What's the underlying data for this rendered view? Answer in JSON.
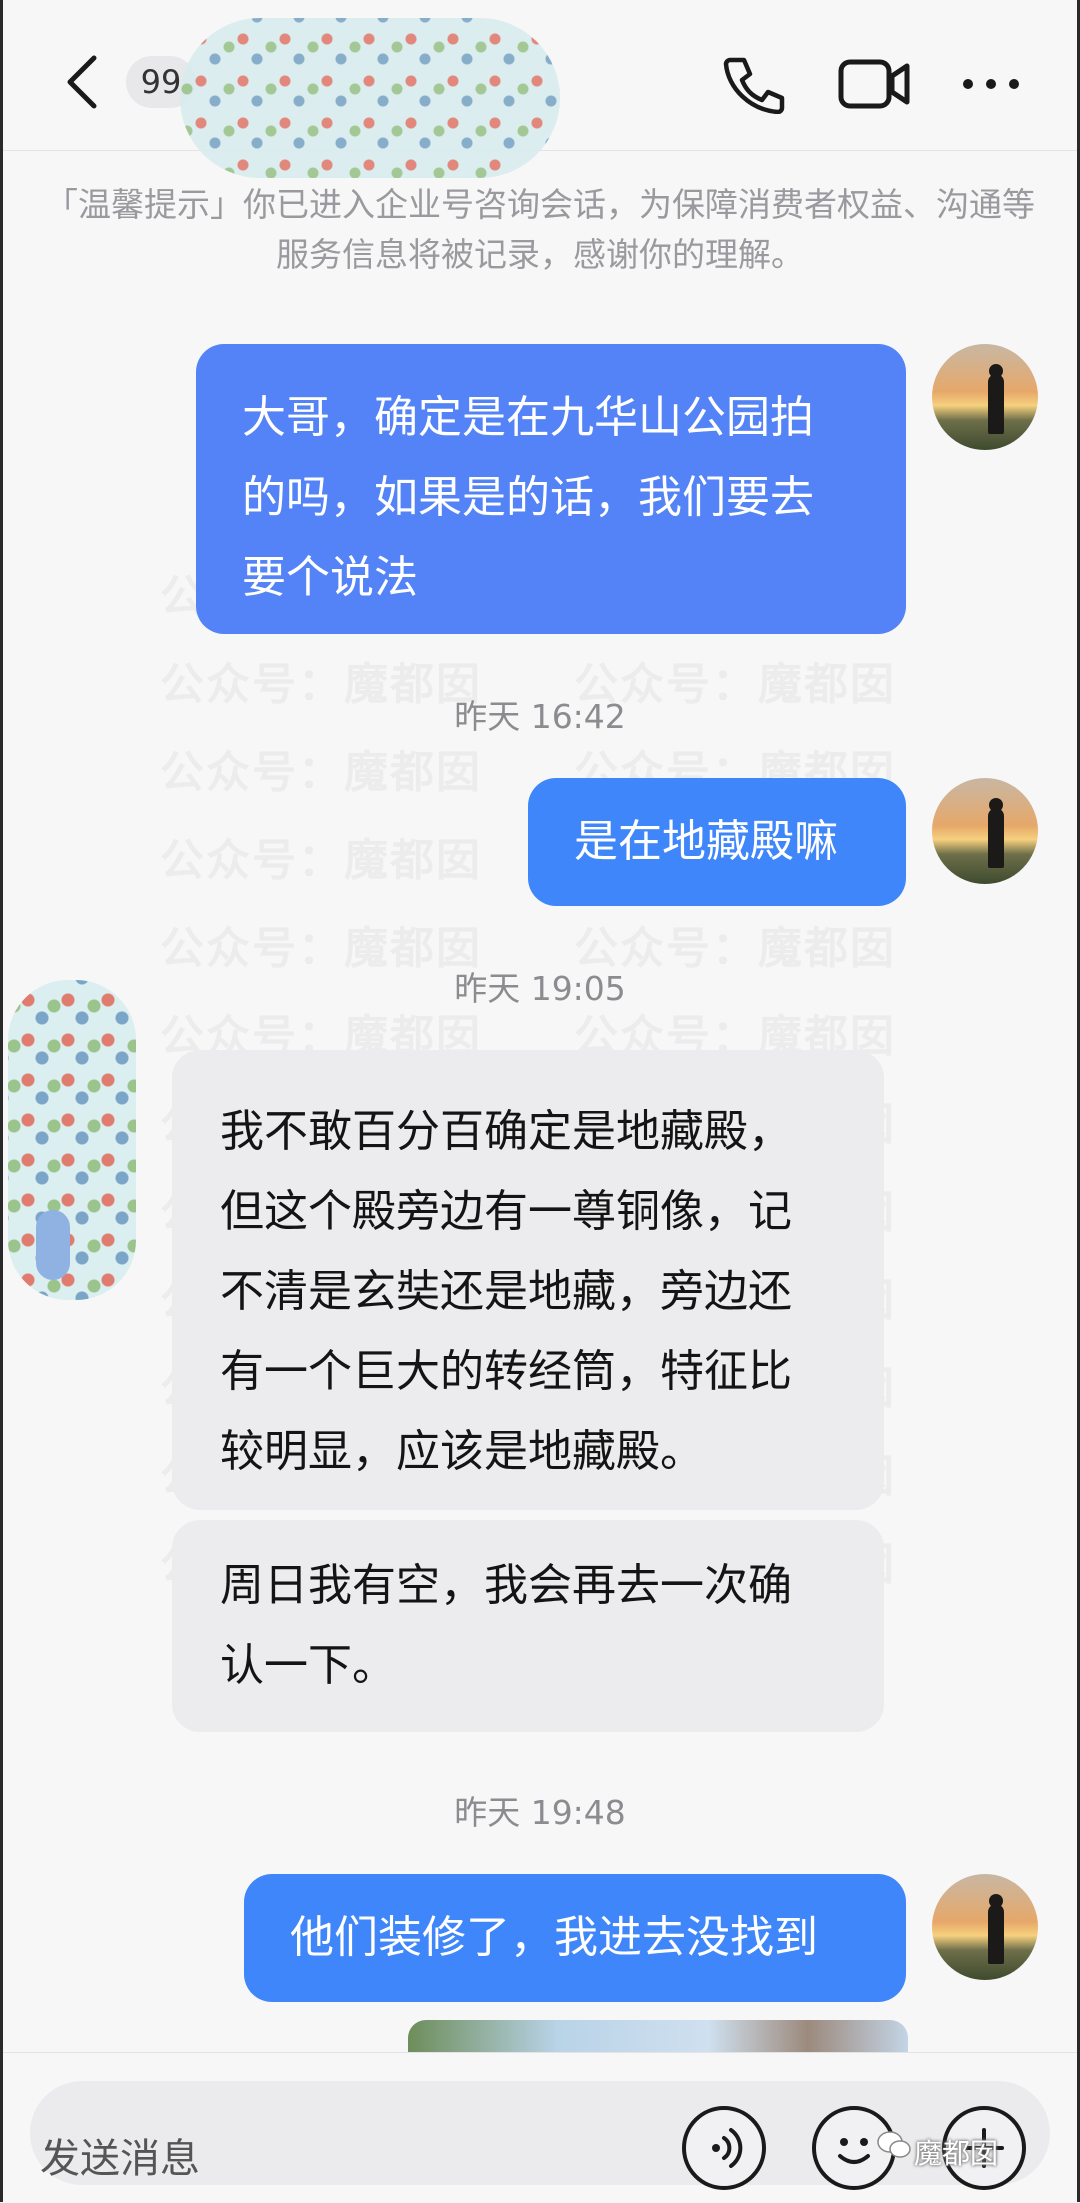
{
  "header": {
    "unread_count": "99",
    "contact_name_redacted": true,
    "icons": [
      "back-icon",
      "phone-icon",
      "video-icon",
      "more-icon"
    ]
  },
  "system_notice": "「温馨提示」你已进入企业号咨询会话，为保障消费者权益、沟通等服务信息将被记录，感谢你的理解。",
  "watermark": {
    "text": "公众号：魔都囡",
    "rows": [
      "公众号：魔都囡　　公众号：魔都囡",
      "公众号：魔都囡　　公众号：魔都囡",
      "公众号：魔都囡　　公众号：魔都囡",
      "公众号：魔都囡　　公众号：魔都囡",
      "公众号：魔都囡　　公众号：魔都囡",
      "公众号：魔都囡　　公众号：魔都囡",
      "公众号：魔都囡　　公众号：魔都囡",
      "公众号：魔都囡　　公众号：魔都囡",
      "公众号：魔都囡　　公众号：魔都囡",
      "公众号：魔都囡　　公众号：魔都囡",
      "公众号：魔都囡　　公众号：魔都囡",
      "公众号：魔都囡　　公众号：魔都囡"
    ]
  },
  "messages": [
    {
      "from": "me",
      "lines": [
        "大哥，确定是在九华山公园拍",
        "的吗，如果是的话，我们要去",
        "要个说法"
      ]
    },
    {
      "time": "昨天 16:42"
    },
    {
      "from": "me",
      "lines": [
        "是在地藏殿嘛"
      ]
    },
    {
      "time": "昨天 19:05"
    },
    {
      "from": "peer",
      "lines": [
        "我不敢百分百确定是地藏殿，",
        "但这个殿旁边有一尊铜像，记",
        "不清是玄奘还是地藏，旁边还",
        "有一个巨大的转经筒，特征比",
        "较明显，应该是地藏殿。"
      ]
    },
    {
      "from": "peer",
      "lines": [
        "周日我有空，我会再去一次确",
        "认一下。"
      ]
    },
    {
      "time": "昨天 19:48"
    },
    {
      "from": "me",
      "lines": [
        "他们装修了，我进去没找到"
      ]
    }
  ],
  "input": {
    "placeholder": "发送消息",
    "icons": [
      "voice-icon",
      "emoji-icon",
      "plus-icon"
    ]
  },
  "source_watermark": "魔都囡",
  "colors": {
    "outgoing_bubble": "#5383f7",
    "outgoing_bubble_alt": "#3f86fa",
    "incoming_bubble": "#ececee",
    "background": "#f7f7f8"
  }
}
